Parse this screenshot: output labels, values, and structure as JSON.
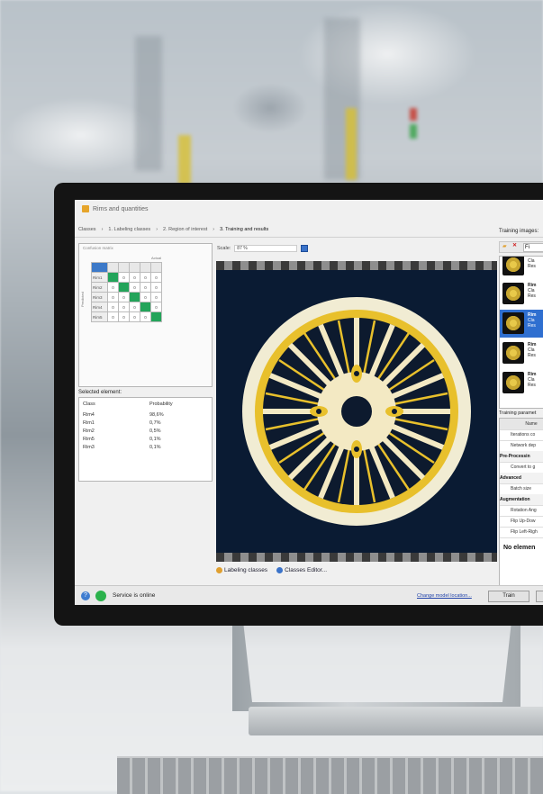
{
  "window": {
    "title": "Rims and quantities"
  },
  "wizard_steps": [
    "Classes",
    "1. Labeling classes",
    "2. Region of interest",
    "3. Training and results"
  ],
  "confusion_matrix": {
    "panel_label": "Confusion matrix",
    "actual_label": "Actual",
    "predicted_label": "Predicted",
    "rows": [
      {
        "label": "Rim1",
        "values": [
          "",
          "0",
          "0",
          "0",
          "0"
        ]
      },
      {
        "label": "Rim2",
        "values": [
          "0",
          "",
          "0",
          "0",
          "0"
        ]
      },
      {
        "label": "Rim3",
        "values": [
          "0",
          "0",
          "",
          "0",
          "0"
        ]
      },
      {
        "label": "Rim4",
        "values": [
          "0",
          "0",
          "0",
          "",
          "0"
        ]
      },
      {
        "label": "Rim5",
        "values": [
          "0",
          "0",
          "0",
          "0",
          ""
        ]
      }
    ]
  },
  "selected_element": {
    "label": "Selected element:",
    "col_class": "Class",
    "col_probability": "Probability",
    "rows": [
      {
        "class": "Rim4",
        "probability": "98,6%"
      },
      {
        "class": "Rim1",
        "probability": "0,7%"
      },
      {
        "class": "Rim2",
        "probability": "0,5%"
      },
      {
        "class": "Rim5",
        "probability": "0,1%"
      },
      {
        "class": "Rim3",
        "probability": "0,1%"
      }
    ]
  },
  "viewer": {
    "scale_label": "Scale:",
    "scale_value": "87 %"
  },
  "bottom_links": {
    "labeling_classes": "Labeling classes",
    "classes_editor": "Classes Editor..."
  },
  "training_images": {
    "label": "Training images:",
    "filter": "Fi",
    "items": [
      {
        "name": "",
        "line1": "Cla",
        "line2": "Res",
        "selected": false
      },
      {
        "name": "Rim",
        "line1": "Cla",
        "line2": "Res",
        "selected": false
      },
      {
        "name": "Rim",
        "line1": "Cla",
        "line2": "Res",
        "selected": true
      },
      {
        "name": "Rim",
        "line1": "Cla",
        "line2": "Res",
        "selected": false
      },
      {
        "name": "Rim",
        "line1": "Cla",
        "line2": "Res",
        "selected": false
      }
    ]
  },
  "training_params": {
    "label": "Training paramet",
    "header": "Name",
    "rows": [
      {
        "text": "Iterations co",
        "section": false
      },
      {
        "text": "Network dep",
        "section": false
      },
      {
        "text": "Pre-Processin",
        "section": true
      },
      {
        "text": "Convert to g",
        "section": false
      },
      {
        "text": "Advanced",
        "section": true
      },
      {
        "text": "Batch size",
        "section": false
      },
      {
        "text": "Augmentation",
        "section": true
      },
      {
        "text": "Rotation Ang",
        "section": false
      },
      {
        "text": "Flip Up-Dow",
        "section": false
      },
      {
        "text": "Flip Left-Righ",
        "section": false
      }
    ],
    "empty_text": "No elemen"
  },
  "status": {
    "service_text": "Service is online",
    "change_model": "Change model location...",
    "train_button": "Train"
  },
  "colors": {
    "accent_blue": "#2f6fd0",
    "online_green": "#2bb24c",
    "matrix_green": "#23a45a",
    "rim_yellow": "#f1d640"
  }
}
